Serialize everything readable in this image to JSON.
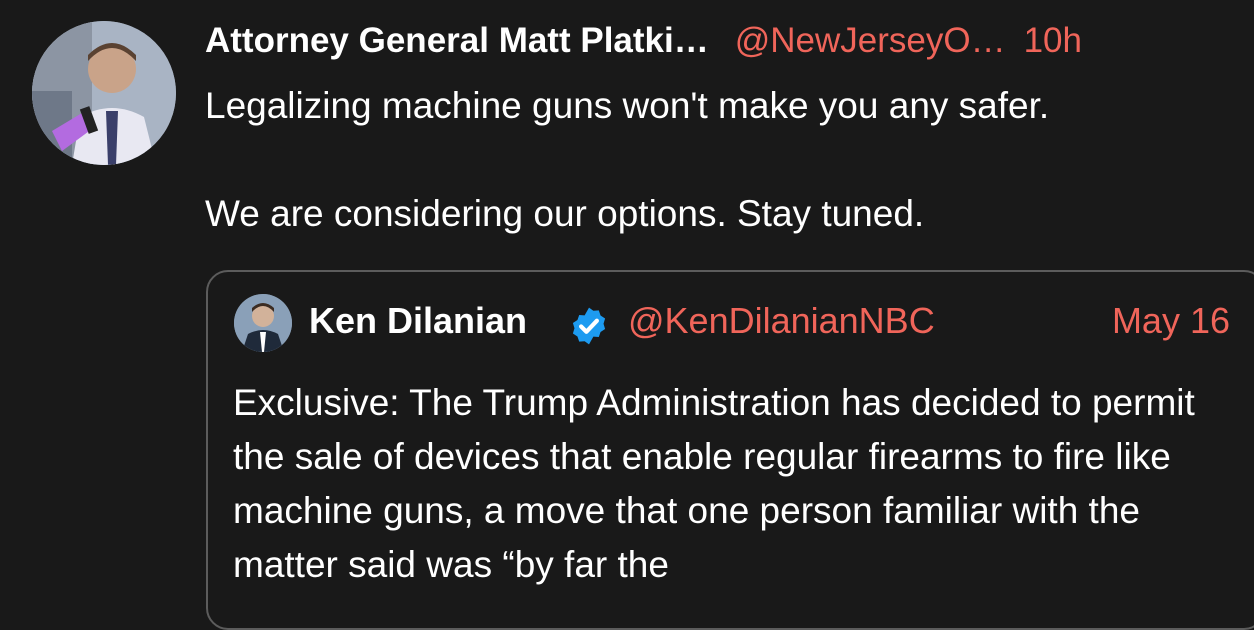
{
  "tweet": {
    "author_name": "Attorney General Matt Platki…",
    "handle": "@NewJerseyO…",
    "time": "10h",
    "text_line1": "Legalizing machine guns won't make you any safer.",
    "text_line2": "We are considering our options. Stay tuned."
  },
  "quote": {
    "author_name": "Ken Dilanian",
    "handle": "@KenDilanianNBC",
    "date": "May 16",
    "text": "Exclusive: The Trump Administration has decided to permit the sale of devices that enable regular firearms to fire like machine guns, a move that one person familiar with the matter said was “by far the"
  },
  "colors": {
    "background": "#191919",
    "accent": "#f0655a",
    "verified": "#1d9bf0",
    "border": "#5c5c5c"
  },
  "icons": {
    "verified": "verified-badge-icon"
  }
}
